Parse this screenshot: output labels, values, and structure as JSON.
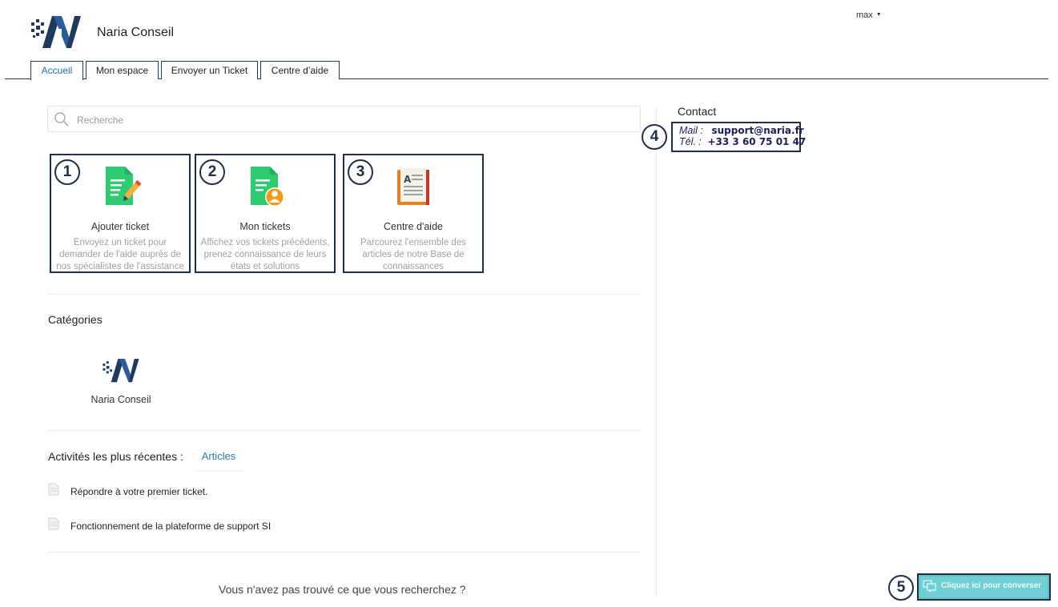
{
  "header": {
    "company_name": "Naria Conseil",
    "user_name": "max",
    "logo_icon": "naria-logo-icon"
  },
  "tabs": [
    {
      "label": "Accueil",
      "active": true
    },
    {
      "label": "Mon espace",
      "active": false
    },
    {
      "label": "Envoyer un Ticket",
      "active": false
    },
    {
      "label": "Centre d’aide",
      "active": false
    }
  ],
  "search": {
    "placeholder": "Recherche",
    "icon": "search-icon"
  },
  "cards": [
    {
      "badge": "1",
      "icon": "document-pencil-icon",
      "title": "Ajouter ticket",
      "description": "Envoyez un ticket pour demander de l'aide auprès de nos spécialistes de l'assistance"
    },
    {
      "badge": "2",
      "icon": "document-user-icon",
      "title": "Mon tickets",
      "description": "Affichez vos tickets précédents, prenez connaissance de leurs états et solutions"
    },
    {
      "badge": "3",
      "icon": "open-book-icon",
      "title": "Centre d'aide",
      "description": "Parcourez l'ensemble des articles de notre Base de connaissances"
    }
  ],
  "categories": {
    "title": "Catégories",
    "items": [
      {
        "label": "Naria Conseil",
        "icon": "naria-logo-icon"
      }
    ]
  },
  "activities": {
    "title": "Activités les plus récentes :",
    "tab_label": "Articles",
    "articles": [
      {
        "title": "Répondre à votre premier ticket.",
        "icon": "document-icon"
      },
      {
        "title": "Fonctionnement de la plateforme de support SI",
        "icon": "document-icon"
      }
    ]
  },
  "not_found_text": "Vous n'avez pas trouvé ce que vous recherchez ?",
  "contact": {
    "title": "Contact",
    "badge": "4",
    "mail_label": "Mail :",
    "mail_value": "support@naria.fr",
    "phone_label": "Tél. :",
    "phone_value": "+33 3 60 75 01 47"
  },
  "chat": {
    "badge": "5",
    "label": "Cliquez ici pour converser",
    "icon": "chat-bubbles-icon"
  },
  "colors": {
    "brand_navy": "#1f3a5c",
    "link_blue": "#2b7ab3",
    "chat_teal": "#6fcfd3",
    "ticket_green": "#2ecc71",
    "user_orange": "#f39c12"
  }
}
